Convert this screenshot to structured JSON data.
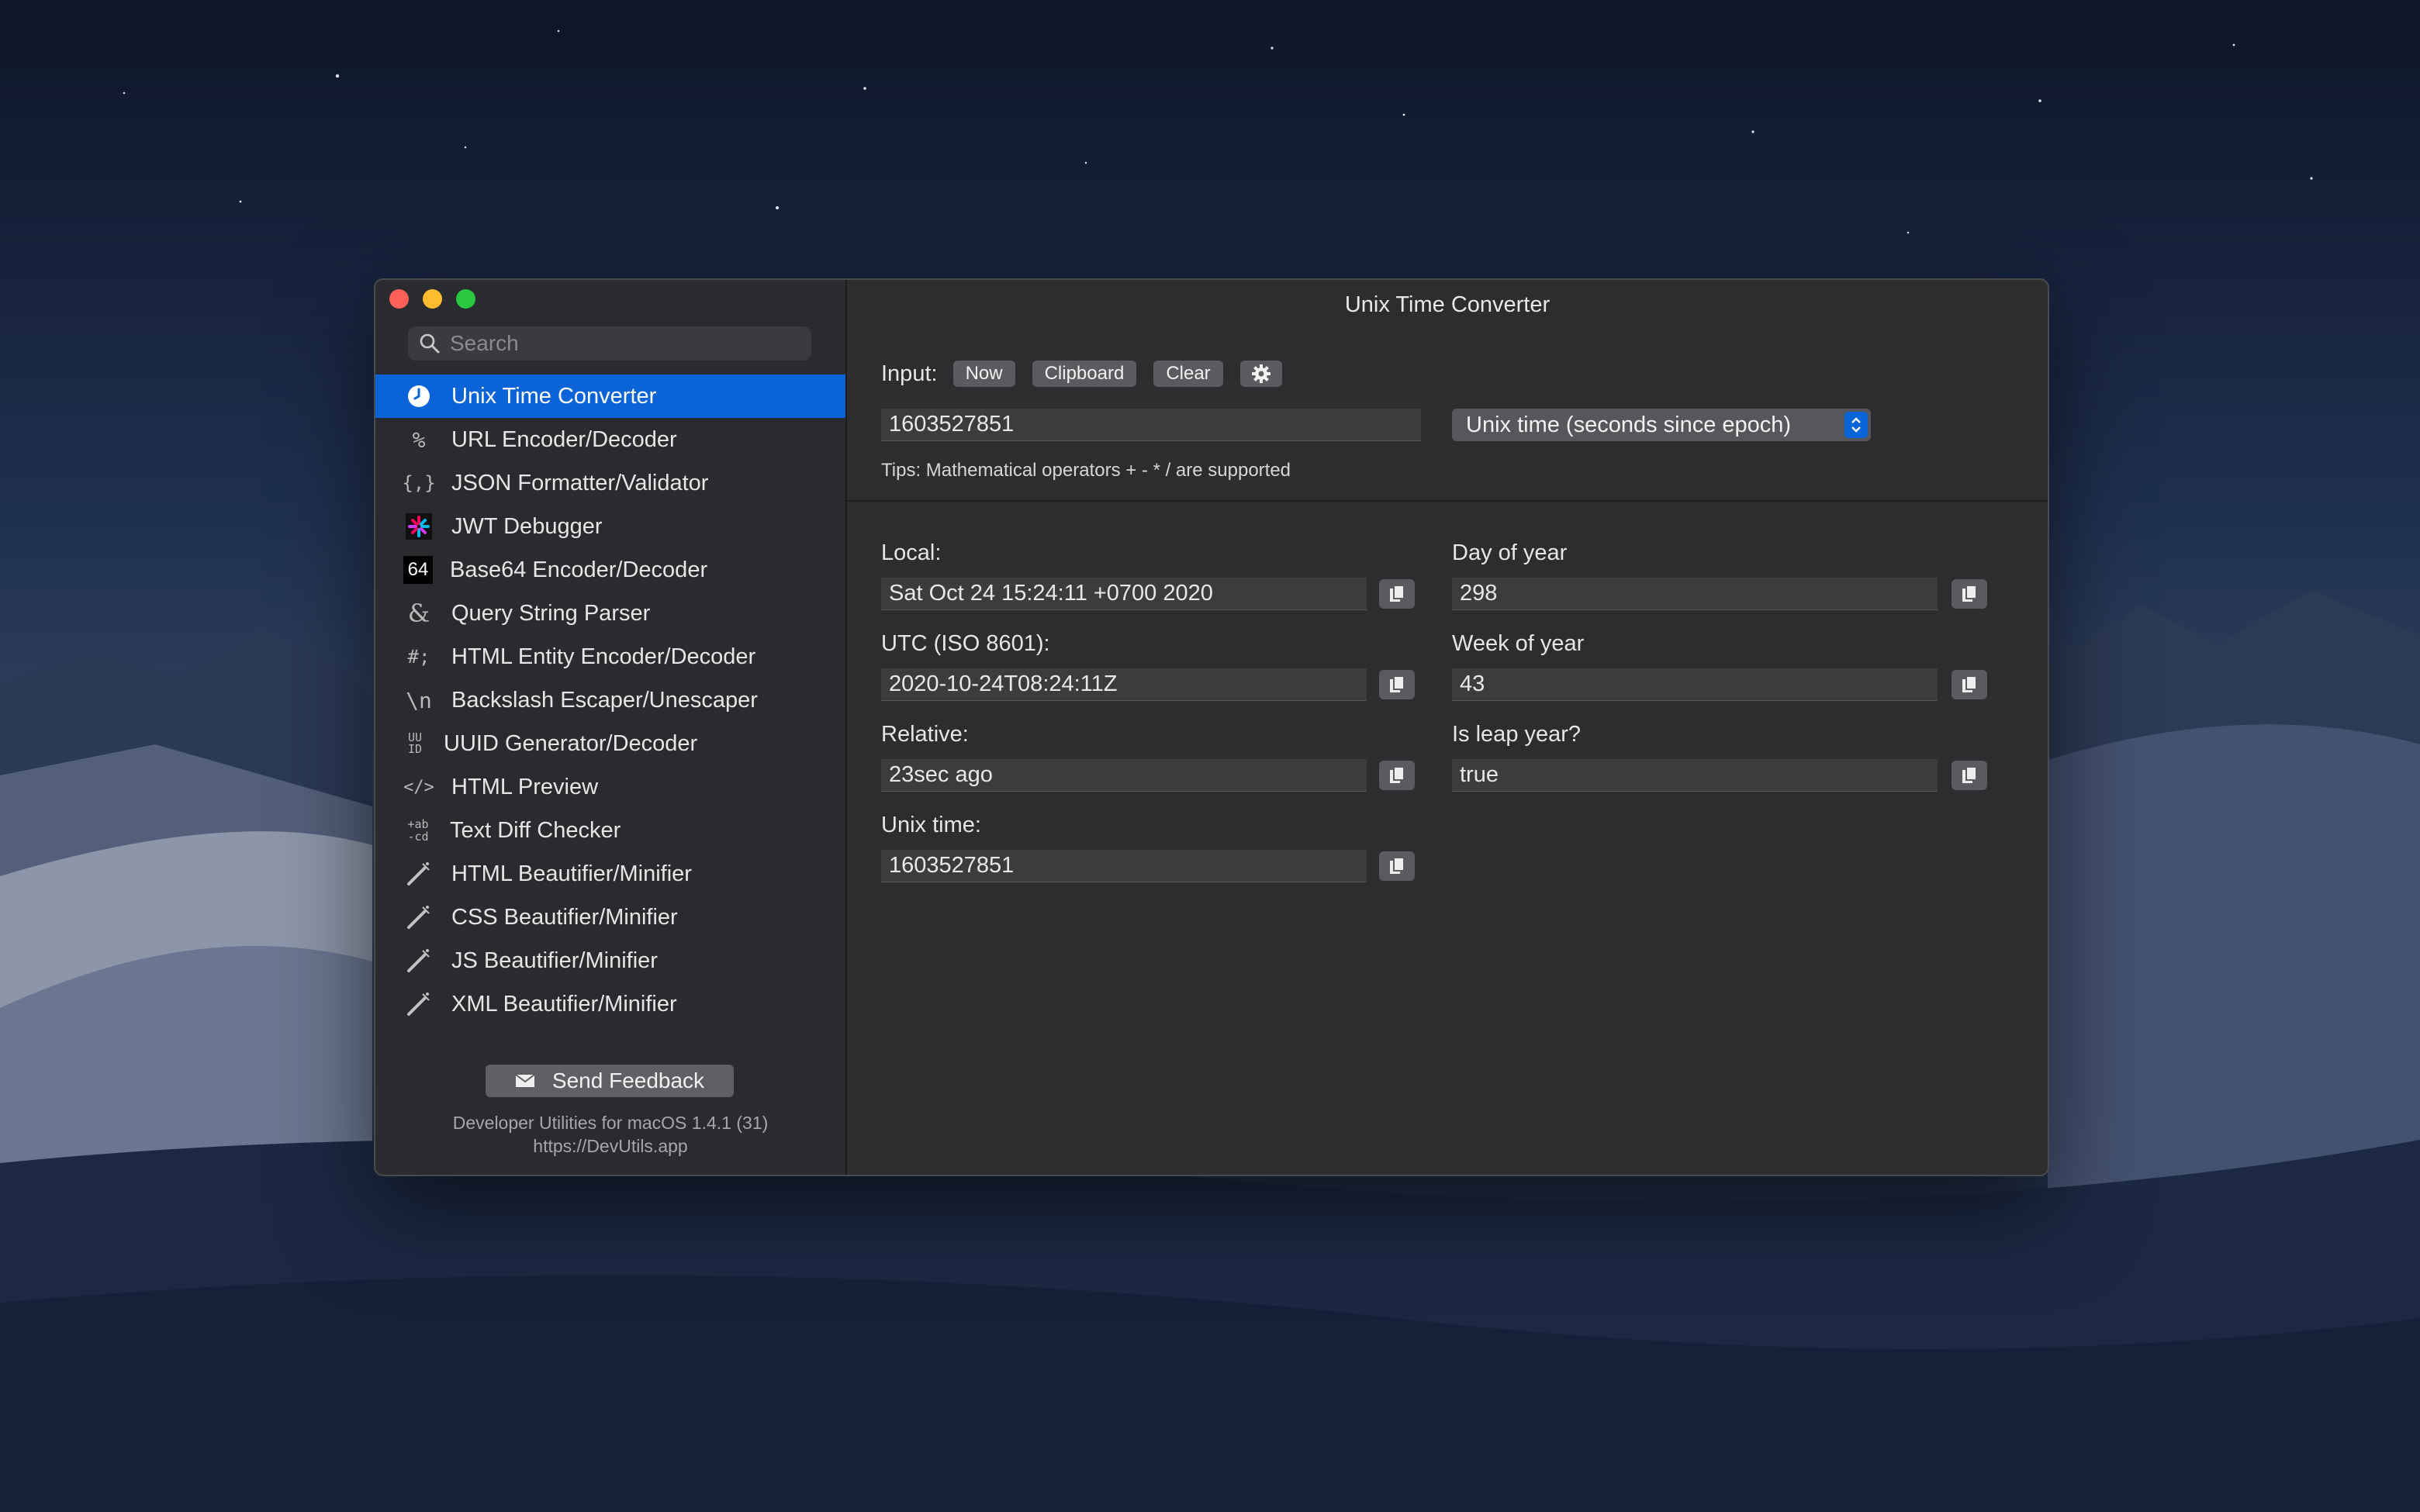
{
  "sidebar": {
    "search_placeholder": "Search",
    "items": [
      {
        "label": "Unix Time Converter",
        "icon": "clock-icon",
        "glyph": ""
      },
      {
        "label": "URL Encoder/Decoder",
        "icon": "percent-icon",
        "glyph": "%"
      },
      {
        "label": "JSON Formatter/Validator",
        "icon": "json-braces-icon",
        "glyph": "{,}"
      },
      {
        "label": "JWT Debugger",
        "icon": "jwt-logo-icon",
        "glyph": ""
      },
      {
        "label": "Base64 Encoder/Decoder",
        "icon": "base64-icon",
        "glyph": "64"
      },
      {
        "label": "Query String Parser",
        "icon": "ampersand-icon",
        "glyph": "&"
      },
      {
        "label": "HTML Entity Encoder/Decoder",
        "icon": "html-entity-icon",
        "glyph": "#;"
      },
      {
        "label": "Backslash Escaper/Unescaper",
        "icon": "backslash-icon",
        "glyph": "\\n"
      },
      {
        "label": "UUID Generator/Decoder",
        "icon": "uuid-icon",
        "glyph": "UU ID"
      },
      {
        "label": "HTML Preview",
        "icon": "code-tag-icon",
        "glyph": "</>"
      },
      {
        "label": "Text Diff Checker",
        "icon": "diff-icon",
        "glyph": "+ab -cd"
      },
      {
        "label": "HTML Beautifier/Minifier",
        "icon": "magic-wand-icon",
        "glyph": ""
      },
      {
        "label": "CSS Beautifier/Minifier",
        "icon": "magic-wand-icon",
        "glyph": ""
      },
      {
        "label": "JS Beautifier/Minifier",
        "icon": "magic-wand-icon",
        "glyph": ""
      },
      {
        "label": "XML Beautifier/Minifier",
        "icon": "magic-wand-icon",
        "glyph": ""
      }
    ],
    "feedback_label": "Send Feedback",
    "about_line1": "Developer Utilities for macOS 1.4.1 (31)",
    "about_line2": "https://DevUtils.app"
  },
  "main": {
    "title": "Unix Time Converter",
    "input_label": "Input:",
    "buttons": {
      "now": "Now",
      "clipboard": "Clipboard",
      "clear": "Clear"
    },
    "input_value": "1603527851",
    "format_select": "Unix time (seconds since epoch)",
    "tips": "Tips: Mathematical operators + - * / are supported",
    "local_label": "Local:",
    "local_value": "Sat Oct 24 15:24:11 +0700 2020",
    "utc_label": "UTC (ISO 8601):",
    "utc_value": "2020-10-24T08:24:11Z",
    "relative_label": "Relative:",
    "relative_value": "23sec ago",
    "unix_label": "Unix time:",
    "unix_value": "1603527851",
    "day_label": "Day of year",
    "day_value": "298",
    "week_label": "Week of year",
    "week_value": "43",
    "leap_label": "Is leap year?",
    "leap_value": "true"
  },
  "colors": {
    "accent": "#0a64d8",
    "close": "#fe5f57",
    "minimize": "#febc2e",
    "maximize": "#28c840"
  }
}
